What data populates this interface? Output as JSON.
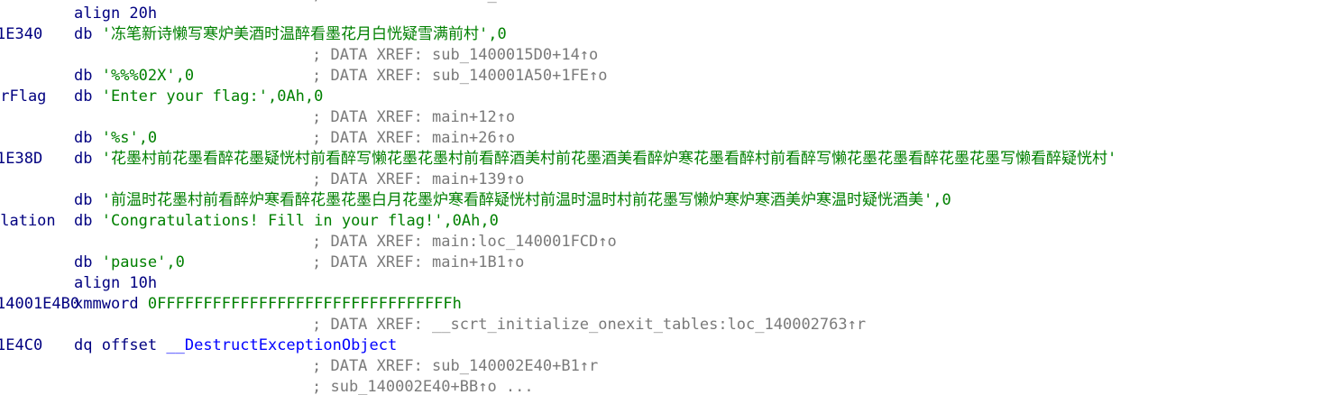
{
  "window": {
    "kind": "IDA disassembly listing (data section)"
  },
  "colors": {
    "background": "#ffffff",
    "mnemonic": "#000080",
    "string_literal": "#008000",
    "number": "#008000",
    "comment_xref": "#7a7a7a",
    "symbol": "#0000ff"
  },
  "lines": [
    {
      "label": "",
      "instr": "align 20h",
      "xref": ""
    },
    {
      "label": "1E340",
      "op": "db",
      "str": "'冻笔新诗懒写寒炉美酒时温醉看墨花月白恍疑雪满前村'",
      "tail": ",0",
      "xref": ""
    },
    {
      "label": "",
      "instr": "",
      "xref": "; DATA XREF: sub_1400015D0+14↑o"
    },
    {
      "label": "",
      "op": "db",
      "str": "'%%%02X'",
      "tail": ",0",
      "xref": "; DATA XREF: sub_140001A50+1FE↑o"
    },
    {
      "label": "urFlag",
      "op": "db",
      "str": "'Enter your flag:'",
      "tail": ",0Ah,0",
      "xref": ""
    },
    {
      "label": "",
      "instr": "",
      "xref": "; DATA XREF: main+12↑o"
    },
    {
      "label": "",
      "op": "db",
      "str": "'%s'",
      "tail": ",0",
      "xref": "; DATA XREF: main+26↑o"
    },
    {
      "label": "1E38D",
      "op": "db",
      "str": "'花墨村前花墨看醉花墨疑恍村前看醉写懒花墨花墨村前看醉酒美村前花墨酒美看醉炉寒花墨看醉村前看醉写懒花墨花墨看醉花墨花墨写懒看醉疑恍村'",
      "tail": "",
      "xref": ""
    },
    {
      "label": "",
      "instr": "",
      "xref": "; DATA XREF: main+139↑o"
    },
    {
      "label": "",
      "op": "db",
      "str": "'前温时花墨村前看醉炉寒看醉花墨花墨白月花墨炉寒看醉疑恍村前温时温时村前花墨写懒炉寒炉寒酒美炉寒温时疑恍酒美'",
      "tail": ",0",
      "xref": ""
    },
    {
      "label": "ulation",
      "op": "db",
      "str": "'Congratulations! Fill in your flag!'",
      "tail": ",0Ah,0",
      "xref": ""
    },
    {
      "label": "",
      "instr": "",
      "xref": "; DATA XREF: main:loc_140001FCD↑o"
    },
    {
      "label": "",
      "op": "db",
      "str": "'pause'",
      "tail": ",0",
      "xref": "; DATA XREF: main+1B1↑o"
    },
    {
      "label": "",
      "instr": "align 10h",
      "xref": ""
    },
    {
      "label": "14001E4B0",
      "op": "xmmword",
      "num": "0FFFFFFFFFFFFFFFFFFFFFFFFFFFFFFFFh",
      "xref": ""
    },
    {
      "label": "",
      "instr": "",
      "xref": "; DATA XREF: __scrt_initialize_onexit_tables:loc_140002763↑r"
    },
    {
      "label": "1E4C0",
      "op": "dq offset",
      "sym": "__DestructExceptionObject",
      "xref": ""
    },
    {
      "label": "",
      "instr": "",
      "xref": "; DATA XREF: sub_140002E40+B1↑r"
    },
    {
      "label": "",
      "instr": "",
      "xref": "; sub_140002E40+BB↑o ..."
    }
  ]
}
